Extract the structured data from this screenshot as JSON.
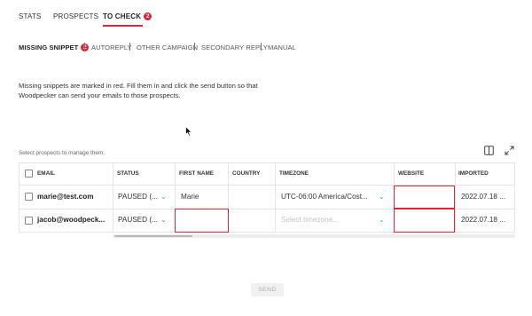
{
  "tabs": [
    {
      "label": "STATS"
    },
    {
      "label": "PROSPECTS"
    },
    {
      "label": "TO CHECK",
      "badge": "2",
      "active": true
    }
  ],
  "subtabs": [
    {
      "label": "MISSING SNIPPET",
      "badge": "2",
      "active": true
    },
    {
      "label": "AUTOREPLY"
    },
    {
      "label": "OTHER CAMPAIGN"
    },
    {
      "label": "SECONDARY REPLY"
    },
    {
      "label": "MANUAL"
    }
  ],
  "description": "Missing snippets are marked in red. Fill them in and click the send button so that Woodpecker can send your emails to those prospects.",
  "hint": "Select prospects to manage them.",
  "table": {
    "columns": [
      "EMAIL",
      "STATUS",
      "FIRST NAME",
      "COUNTRY",
      "TIMEZONE",
      "WEBSITE",
      "IMPORTED"
    ],
    "rows": [
      {
        "email": "marie@test.com",
        "status": "PAUSED (...",
        "first_name": "Marie",
        "country": "",
        "timezone": "UTC-06:00 America/Cost...",
        "website": "",
        "imported": "2022.07.18 ..."
      },
      {
        "email": "jacob@woodpeck...",
        "status": "PAUSED (...",
        "first_name": "",
        "country": "",
        "timezone": "",
        "website": "",
        "imported": "2022.07.18 ..."
      }
    ],
    "timezone_placeholder": "Select timezone..."
  },
  "send_label": "SEND",
  "colors": {
    "accent": "#d9263c",
    "chevron": "#5a9e6f"
  },
  "icons": [
    "columns-icon",
    "expand-icon",
    "cursor-icon",
    "chevron-down-icon"
  ]
}
